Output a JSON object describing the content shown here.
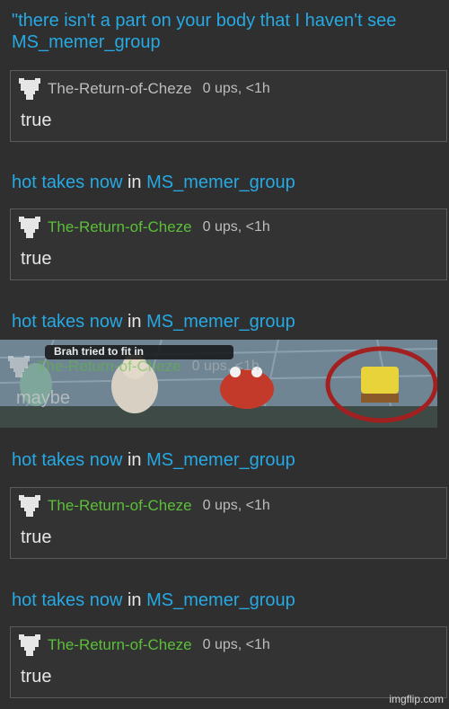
{
  "header": {
    "title": "\"there isn't a part on your body that I haven't see",
    "group": "MS_memer_group"
  },
  "comments": [
    {
      "user": "The-Return-of-Cheze",
      "meta": "0 ups, <1h",
      "body": "true"
    },
    {
      "user": "The-Return-of-Cheze",
      "meta": "0 ups, <1h",
      "body": "true"
    },
    {
      "user": "The-Return-of-Cheze",
      "meta": "0 ups, <1h",
      "body": "maybe"
    },
    {
      "user": "The-Return-of-Cheze",
      "meta": "0 ups, <1h",
      "body": "true"
    },
    {
      "user": "The-Return-of-Cheze",
      "meta": "0 ups, <1h",
      "body": "true"
    }
  ],
  "posts": [
    {
      "title": "hot takes now",
      "in": "in",
      "group": "MS_memer_group"
    },
    {
      "title": "hot takes now",
      "in": "in",
      "group": "MS_memer_group"
    },
    {
      "title": "hot takes now",
      "in": "in",
      "group": "MS_memer_group"
    },
    {
      "title": "hot takes now",
      "in": "in",
      "group": "MS_memer_group"
    }
  ],
  "meme_caption": "Brah tried to fit in",
  "watermark": "imgflip.com",
  "colors": {
    "link": "#27a9e3",
    "username_green": "#5cbf3a",
    "background": "#2f2f2f"
  }
}
